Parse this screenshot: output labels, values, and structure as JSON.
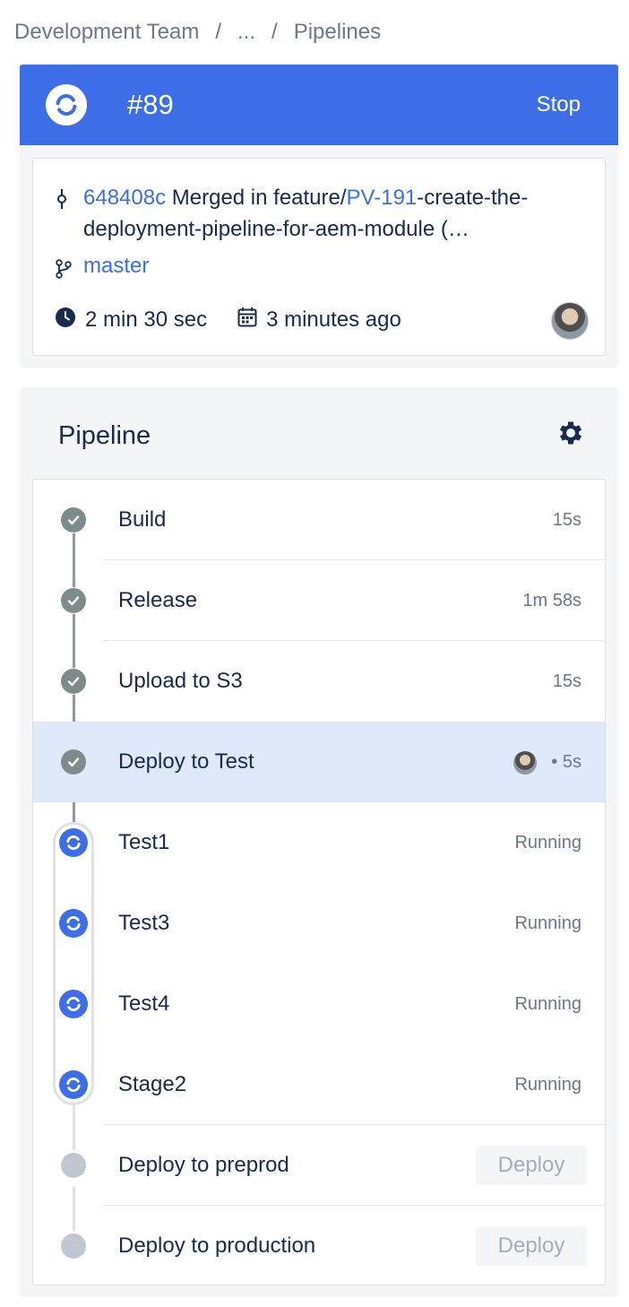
{
  "breadcrumb": {
    "team": "Development Team",
    "ellipsis": "...",
    "current": "Pipelines",
    "separator": "/"
  },
  "run": {
    "number": "#89",
    "stop_label": "Stop",
    "color": "#3d6ee8"
  },
  "commit": {
    "hash": "648408c",
    "message_prefix": " Merged in feature/",
    "issue": "PV-191",
    "message_suffix": "-create-the-deployment-pipeline-for-aem-module (…",
    "branch": "master",
    "duration": "2 min 30 sec",
    "started": "3 minutes ago"
  },
  "pipeline": {
    "title": "Pipeline",
    "steps": [
      {
        "name": "Build",
        "status": "done",
        "duration": "15s"
      },
      {
        "name": "Release",
        "status": "done",
        "duration": "1m 58s"
      },
      {
        "name": "Upload to S3",
        "status": "done",
        "duration": "15s"
      },
      {
        "name": "Deploy to Test",
        "status": "done",
        "duration": "5s",
        "dot": "•"
      },
      {
        "name": "Test1",
        "status": "running",
        "duration": "Running"
      },
      {
        "name": "Test3",
        "status": "running",
        "duration": "Running"
      },
      {
        "name": "Test4",
        "status": "running",
        "duration": "Running"
      },
      {
        "name": "Stage2",
        "status": "running",
        "duration": "Running"
      },
      {
        "name": "Deploy to preprod",
        "status": "pending",
        "action": "Deploy"
      },
      {
        "name": "Deploy to production",
        "status": "pending",
        "action": "Deploy"
      }
    ]
  }
}
